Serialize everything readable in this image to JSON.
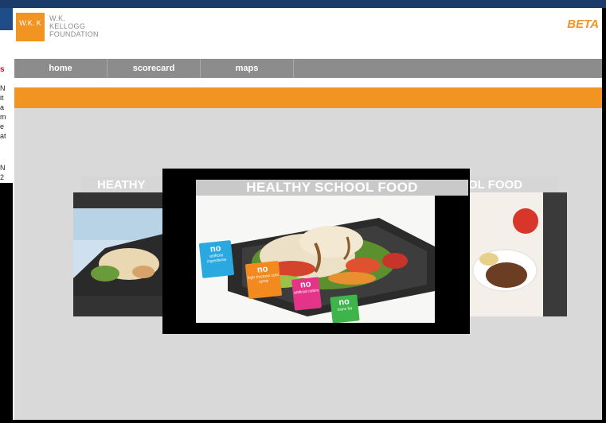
{
  "under_page": {
    "sidebar_lines": [
      "s",
      "N",
      "it",
      "a",
      "m",
      "e",
      "at",
      "",
      "N",
      "2"
    ]
  },
  "header": {
    "logo_mark": "W.K. K",
    "logo_lines": [
      "W.K.",
      "KELLOGG",
      "FOUNDATION"
    ],
    "beta": "BETA"
  },
  "nav": {
    "items": [
      {
        "label": "home"
      },
      {
        "label": "scorecard"
      },
      {
        "label": "maps"
      },
      {
        "label": ""
      }
    ]
  },
  "carousel": {
    "left_title": "HEATHY",
    "center_title": "HEALTHY SCHOOL FOOD",
    "right_title": "OL FOOD",
    "tags": [
      {
        "big": "no",
        "small": "artificial ingredients",
        "color": "#29a9e0"
      },
      {
        "big": "no",
        "small": "high fructose corn syrup",
        "color": "#f28a1f"
      },
      {
        "big": "no",
        "small": "artificial colors",
        "color": "#e6338a"
      },
      {
        "big": "no",
        "small": "trans fat",
        "color": "#3db54a"
      }
    ]
  },
  "colors": {
    "accent": "#f29422",
    "nav": "#8c8c8c",
    "stage": "#d9d9d9"
  }
}
